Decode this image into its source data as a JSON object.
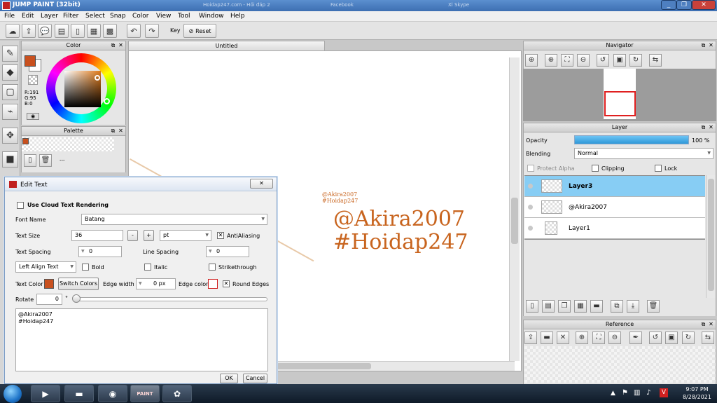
{
  "window": {
    "title": "JUMP PAINT (32bit)",
    "ghost_tabs": [
      "Hoidap247.com - Hỏi đáp 2",
      "Facebook",
      "Xl Skype"
    ],
    "controls": [
      "_",
      "❐",
      "✕"
    ]
  },
  "menu": [
    "File",
    "Edit",
    "Layer",
    "Filter",
    "Select",
    "Snap",
    "Color",
    "View",
    "Tool",
    "Window",
    "Help"
  ],
  "toolbar": {
    "key_label": "Key",
    "reset_label": "Reset"
  },
  "color_panel": {
    "title": "Color",
    "main_color": "#c8501e",
    "rgb": [
      "R:191",
      "G:95",
      "B:0"
    ]
  },
  "palette_panel": {
    "title": "Palette",
    "ellipsis": "---"
  },
  "canvas": {
    "tab": "Untitled",
    "small_text": [
      "@Akira2007",
      "#Hoidap247"
    ],
    "large_text": [
      "@Akira2007",
      "#Hoidap247"
    ],
    "text_color": "#c8641e"
  },
  "edit_text": {
    "title": "Edit Text",
    "close": "✕",
    "cloud_label": "Use Cloud Text Rendering",
    "font_name_label": "Font Name",
    "font_name": "Batang",
    "text_size_label": "Text Size",
    "text_size": "36",
    "minus": "-",
    "plus": "+",
    "unit": "pt",
    "antialias_label": "AntiAliasing",
    "text_spacing_label": "Text Spacing",
    "text_spacing": "0",
    "line_spacing_label": "Line Spacing",
    "line_spacing": "0",
    "align": "Left Align Text",
    "bold_label": "Bold",
    "italic_label": "Italic",
    "strike_label": "Strikethrough",
    "text_color_label": "Text Color",
    "text_color": "#c8501e",
    "switch_colors": "Switch Colors",
    "edge_width_label": "Edge width",
    "edge_width": "0 px",
    "edge_color_label": "Edge color",
    "round_edges_label": "Round Edges",
    "rotate_label": "Rotate",
    "rotate": "0",
    "degree": "°",
    "content": [
      "@Akira2007",
      "#Hoidap247"
    ],
    "ok": "OK",
    "cancel": "Cancel"
  },
  "navigator": {
    "title": "Navigator"
  },
  "layer_panel": {
    "title": "Layer",
    "opacity_label": "Opacity",
    "opacity": "100 %",
    "opacity_fraction": 1.0,
    "blending_label": "Blending",
    "blending": "Normal",
    "protect_alpha": "Protect Alpha",
    "clipping": "Clipping",
    "lock": "Lock",
    "layers": [
      "Layer3",
      "@Akira2007",
      "Layer1"
    ]
  },
  "reference_panel": {
    "title": "Reference"
  },
  "taskbar": {
    "time": "9:07 PM",
    "date": "8/28/2021",
    "app_badge": "PAINT"
  }
}
